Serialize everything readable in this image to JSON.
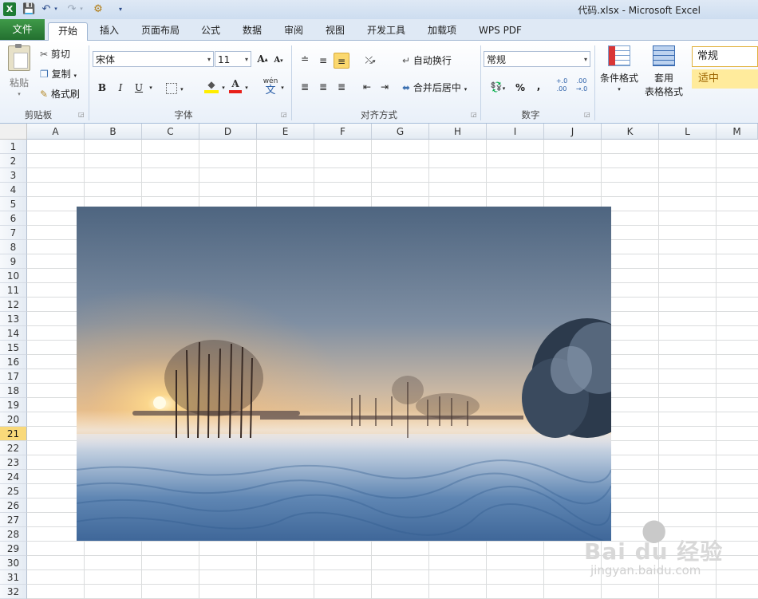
{
  "window": {
    "title": "代码.xlsx - Microsoft Excel"
  },
  "tabs": [
    {
      "label": "文件"
    },
    {
      "label": "开始"
    },
    {
      "label": "插入"
    },
    {
      "label": "页面布局"
    },
    {
      "label": "公式"
    },
    {
      "label": "数据"
    },
    {
      "label": "审阅"
    },
    {
      "label": "视图"
    },
    {
      "label": "开发工具"
    },
    {
      "label": "加载项"
    },
    {
      "label": "WPS PDF"
    }
  ],
  "ribbon": {
    "clipboard": {
      "paste": "粘贴",
      "cut": "剪切",
      "copy": "复制",
      "format_painter": "格式刷",
      "group_label": "剪贴板"
    },
    "font": {
      "font_name": "宋体",
      "font_size": "11",
      "bold": "B",
      "italic": "I",
      "underline": "U",
      "font_color_glyph": "A",
      "phonetic": "wén",
      "group_label": "字体"
    },
    "alignment": {
      "wrap_text": "自动换行",
      "merge_center": "合并后居中",
      "group_label": "对齐方式"
    },
    "number": {
      "format": "常规",
      "percent": "%",
      "comma": ",",
      "inc_decimal": "+.0 .00",
      "dec_decimal": ".00 →.0",
      "group_label": "数字"
    },
    "styles": {
      "conditional_format": "条件格式",
      "table_format_1": "套用",
      "table_format_2": "表格格式",
      "style_normal": "常规",
      "style_neutral": "适中"
    }
  },
  "sheet": {
    "columns": [
      "A",
      "B",
      "C",
      "D",
      "E",
      "F",
      "G",
      "H",
      "I",
      "J",
      "K",
      "L",
      "M"
    ],
    "rows": [
      "1",
      "2",
      "3",
      "4",
      "5",
      "6",
      "7",
      "8",
      "9",
      "10",
      "11",
      "12",
      "13",
      "14",
      "15",
      "16",
      "17",
      "18",
      "19",
      "20",
      "21",
      "22",
      "23",
      "24",
      "25",
      "26",
      "27",
      "28",
      "29",
      "30",
      "31",
      "32"
    ],
    "active_row": "21"
  },
  "watermark": {
    "brand": "Bai du 经验",
    "url": "jingyan.baidu.com"
  },
  "colors": {
    "file_tab": "#2f7f3a",
    "active_row_header": "#f9d97a",
    "neutral_style": "#ffeb9c"
  }
}
